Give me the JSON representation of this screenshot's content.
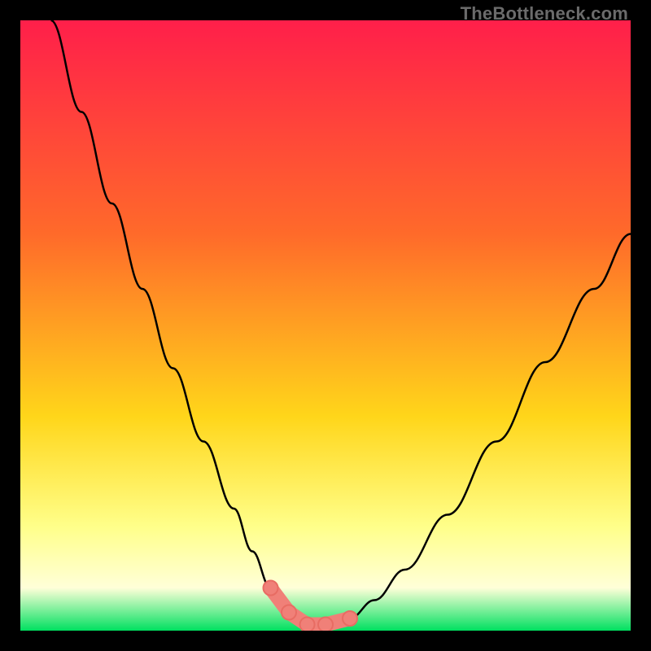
{
  "watermark": "TheBottleneck.com",
  "colors": {
    "frame": "#000000",
    "line": "#000000",
    "sausage_fill": "#f08078",
    "sausage_stroke": "#e86c63",
    "gradient": {
      "top": "#ff1f4a",
      "mid1": "#ff6a2a",
      "mid2": "#ffd61a",
      "mid3": "#ffff8a",
      "mid4": "#ffffd8",
      "bottom": "#00e060"
    }
  },
  "chart_data": {
    "type": "line",
    "title": "",
    "xlabel": "",
    "ylabel": "",
    "xlim": [
      0,
      100
    ],
    "ylim": [
      0,
      100
    ],
    "grid": false,
    "legend": false,
    "series": [
      {
        "name": "bottleneck-curve",
        "x": [
          5,
          10,
          15,
          20,
          25,
          30,
          35,
          38,
          41,
          44,
          47,
          50,
          54,
          58,
          63,
          70,
          78,
          86,
          94,
          100
        ],
        "y": [
          100,
          85,
          70,
          56,
          43,
          31,
          20,
          13,
          7,
          3,
          1,
          1,
          2,
          5,
          10,
          19,
          31,
          44,
          56,
          65
        ]
      }
    ],
    "annotations": [
      {
        "name": "sausage-segments",
        "shape": "capsule-chain",
        "x": [
          41,
          44,
          47,
          50,
          54
        ],
        "y": [
          7,
          3,
          1,
          1,
          2
        ]
      }
    ]
  }
}
